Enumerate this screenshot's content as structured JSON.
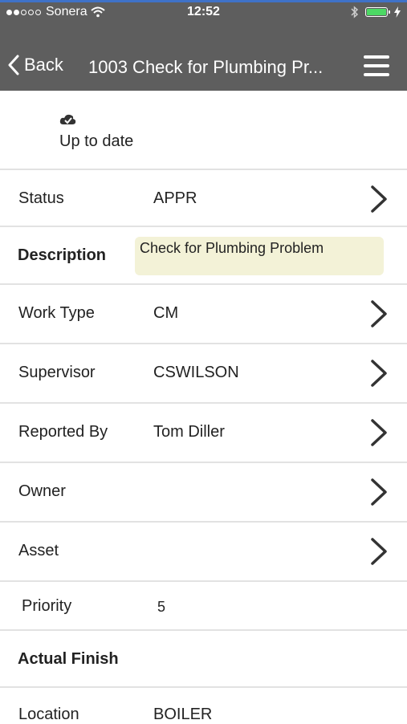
{
  "status_bar": {
    "carrier": "Sonera",
    "time": "12:52"
  },
  "nav": {
    "back_label": "Back",
    "title": "1003 Check for Plumbing Pr..."
  },
  "sync": {
    "status_text": "Up to date"
  },
  "fields": {
    "status": {
      "label": "Status",
      "value": "APPR"
    },
    "description": {
      "label": "Description",
      "value": "Check for Plumbing Problem"
    },
    "work_type": {
      "label": "Work Type",
      "value": "CM"
    },
    "supervisor": {
      "label": "Supervisor",
      "value": "CSWILSON"
    },
    "reported_by": {
      "label": "Reported By",
      "value": "Tom Diller"
    },
    "owner": {
      "label": "Owner",
      "value": ""
    },
    "asset": {
      "label": "Asset",
      "value": ""
    },
    "priority": {
      "label": "Priority",
      "value": "5"
    },
    "actual_finish": {
      "label": "Actual Finish",
      "value": ""
    },
    "location": {
      "label": "Location",
      "value": "BOILER"
    }
  },
  "colors": {
    "header_bg": "#5e5e5e",
    "description_bg": "#f3f2d7",
    "battery": "#4cd964",
    "accent": "#3f72c8"
  }
}
